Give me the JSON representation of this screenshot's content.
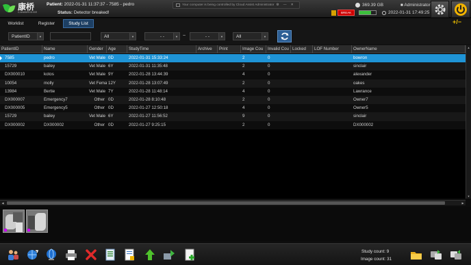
{
  "header": {
    "logo_cn": "康桥",
    "logo_en": "CAMBRIDGE",
    "patient_label": "Patient:",
    "patient_info": "2022-01-31 11:37:37 - 7585 - pedro",
    "status_label": "Status:",
    "status_text": "Detector breaked!",
    "remote_banner": "Your computer is being controlled by Cloud Assist Administrator",
    "disk_free": "369.39 GB",
    "user": "Administrator",
    "break_badge": "BREAK",
    "datetime": "2022-01-31 17:49:25",
    "battery_level": 0.7
  },
  "tabs": [
    {
      "label": "Worklist",
      "active": false
    },
    {
      "label": "Register",
      "active": false
    },
    {
      "label": "Study List",
      "active": true
    }
  ],
  "plus_minus": "+/−",
  "filters": {
    "field": "PatientID",
    "gender": "All",
    "date_from": "- -",
    "tilde": "~",
    "date_to": "- -",
    "modality": "All"
  },
  "table": {
    "columns": [
      "PatientID",
      "Name",
      "Gender",
      "Age",
      "StudyTime",
      "Archive",
      "Print",
      "Image Cou",
      "Invalid Cou",
      "Locked",
      "LOF Number",
      "OwnerName"
    ],
    "rows": [
      {
        "cells": [
          "7585",
          "pedro",
          "Vet Male",
          "0D",
          "2022-01-31 15:33:24",
          "",
          "",
          "2",
          "0",
          "",
          "",
          "bowron"
        ],
        "selected": true
      },
      {
        "cells": [
          "15729",
          "bailey",
          "Vet Male",
          "6Y",
          "2022-01-31 11:35:48",
          "",
          "",
          "2",
          "0",
          "",
          "",
          "sinclair"
        ],
        "selected": false
      },
      {
        "cells": [
          "DX000010",
          "kotos",
          "Vet Male",
          "9Y",
          "2022-01-28 13:44:39",
          "",
          "",
          "4",
          "0",
          "",
          "",
          "alexander"
        ],
        "selected": false
      },
      {
        "cells": [
          "10054",
          "molly",
          "Vet Femal",
          "12Y",
          "2022-01-28 13:07:49",
          "",
          "",
          "2",
          "0",
          "",
          "",
          "oakes"
        ],
        "selected": false
      },
      {
        "cells": [
          "13984",
          "Bertie",
          "Vet Male",
          "7Y",
          "2022-01-28 11:48:14",
          "",
          "",
          "4",
          "0",
          "",
          "",
          "Lawrance"
        ],
        "selected": false
      },
      {
        "cells": [
          "DX000007",
          "Emergency7",
          "Other",
          "0D",
          "2022-01-28 8:10:48",
          "",
          "",
          "2",
          "0",
          "",
          "",
          "Owner7"
        ],
        "selected": false
      },
      {
        "cells": [
          "DX000005",
          "Emergency5",
          "Other",
          "0D",
          "2022-01-27 12:50:18",
          "",
          "",
          "4",
          "0",
          "",
          "",
          "Owner5"
        ],
        "selected": false
      },
      {
        "cells": [
          "15729",
          "bailey",
          "Vet Male",
          "6Y",
          "2022-01-27 11:56:52",
          "",
          "",
          "9",
          "0",
          "",
          "",
          "sinclair"
        ],
        "selected": false
      },
      {
        "cells": [
          "DX000002",
          "DX000002",
          "Other",
          "0D",
          "2022-01-27 9:25:15",
          "",
          "",
          "2",
          "0",
          "",
          "",
          "DX000002"
        ],
        "selected": false
      }
    ]
  },
  "thumbnails": [
    {
      "name": "xray-thumbnail-1"
    },
    {
      "name": "xray-thumbnail-2"
    }
  ],
  "footer": {
    "study_count_label": "Study count:",
    "study_count": "9",
    "image_count_label": "Image count:",
    "image_count": "31"
  },
  "toolbar_icons": [
    "patient-icon",
    "globe-sync-icon",
    "network-icon",
    "printer-icon",
    "delete-icon",
    "export-icon",
    "report-icon",
    "upload-icon",
    "transfer-icon",
    "new-document-icon",
    "folder-icon",
    "send-icon",
    "receive-icon"
  ],
  "colors": {
    "selected_row": "#1f94d6",
    "active_tab": "#1d3f63",
    "break_badge": "#cc0000",
    "power_icon": "#f2b400"
  }
}
